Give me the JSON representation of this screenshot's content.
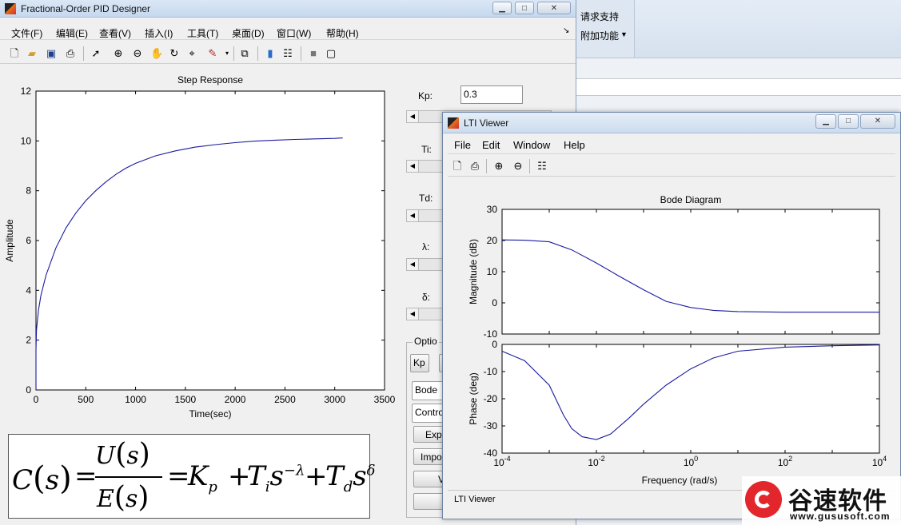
{
  "bg_ribbon": {
    "item1": "请求支持",
    "item2": "附加功能"
  },
  "pid_window": {
    "title": "Fractional-Order PID Designer",
    "menu": [
      "文件(F)",
      "编辑(E)",
      "查看(V)",
      "插入(I)",
      "工具(T)",
      "桌面(D)",
      "窗口(W)",
      "帮助(H)"
    ],
    "toolbar_icons": [
      "new-file-icon",
      "open-folder-icon",
      "save-icon",
      "print-icon",
      "pointer-icon",
      "zoom-in-icon",
      "zoom-out-icon",
      "pan-hand-icon",
      "rotate-3d-icon",
      "data-cursor-icon",
      "brush-icon",
      "link-icon",
      "colorbar-icon",
      "legend-icon",
      "hide-plot-icon",
      "show-plot-icon"
    ],
    "params": {
      "kp_label": "Kp:",
      "kp_value": "0.3",
      "ti_label": "Ti:",
      "td_label": "Td:",
      "lambda_label": "λ:",
      "delta_label": "δ:"
    },
    "options": {
      "group_label": "Optio",
      "kp_button": "Kp",
      "bode_select": "Bode",
      "control_select": "Contro",
      "export_button": "Exp",
      "import_button": "Impo",
      "btn3": "V"
    },
    "formula": {
      "lhs": "C",
      "s": "s",
      "eq": "=",
      "U": "U",
      "E": "E",
      "Kp": "K",
      "p": "p",
      "plus": "+",
      "Ti": "T",
      "i": "i",
      "Td": "T",
      "d": "d",
      "exp_lambda": "−λ",
      "exp_delta": "δ"
    }
  },
  "lti_window": {
    "title": "LTI Viewer",
    "menu": [
      "File",
      "Edit",
      "Window",
      "Help"
    ],
    "status": "LTI Viewer"
  },
  "watermark": {
    "brand": "谷速软件",
    "url": "www.gususoft.com"
  },
  "chart_data": [
    {
      "type": "line",
      "title": "Step Response",
      "xlabel": "Time(sec)",
      "ylabel": "Amplitude",
      "xlim": [
        0,
        3500
      ],
      "ylim": [
        0,
        12
      ],
      "xticks": [
        "0",
        "500",
        "1000",
        "1500",
        "2000",
        "2500",
        "3000",
        "3500"
      ],
      "yticks": [
        "0",
        "2",
        "4",
        "6",
        "8",
        "10",
        "12"
      ],
      "x": [
        0,
        5,
        25,
        50,
        100,
        200,
        300,
        400,
        500,
        600,
        700,
        800,
        900,
        1000,
        1200,
        1400,
        1600,
        1800,
        2000,
        2200,
        2400,
        2600,
        2800,
        3000,
        3080
      ],
      "y": [
        1.6,
        2.4,
        3.2,
        3.8,
        4.6,
        5.7,
        6.5,
        7.1,
        7.6,
        8.0,
        8.35,
        8.65,
        8.9,
        9.1,
        9.4,
        9.6,
        9.75,
        9.85,
        9.93,
        9.99,
        10.03,
        10.06,
        10.08,
        10.1,
        10.12
      ]
    },
    {
      "type": "line",
      "title": "Bode Diagram",
      "xlabel": "Frequency  (rad/s)",
      "xscale": "log",
      "xticks": [
        "10^-4",
        "10^-2",
        "10^0",
        "10^2",
        "10^4"
      ],
      "panels": [
        {
          "ylabel": "Magnitude (dB)",
          "ylim": [
            -10,
            30
          ],
          "yticks": [
            "-10",
            "0",
            "10",
            "20",
            "30"
          ],
          "x": [
            0.0001,
            0.0003,
            0.001,
            0.003,
            0.01,
            0.03,
            0.1,
            0.3,
            1,
            3,
            10,
            100,
            1000,
            10000
          ],
          "y": [
            20.2,
            20.1,
            19.6,
            17.0,
            12.8,
            8.6,
            4.2,
            0.5,
            -1.5,
            -2.4,
            -2.8,
            -3.0,
            -3.0,
            -3.0
          ]
        },
        {
          "ylabel": "Phase (deg)",
          "ylim": [
            -40,
            0
          ],
          "yticks": [
            "-40",
            "-30",
            "-20",
            "-10",
            "0"
          ],
          "x": [
            0.0001,
            0.0003,
            0.001,
            0.002,
            0.003,
            0.005,
            0.01,
            0.02,
            0.05,
            0.1,
            0.3,
            1,
            3,
            10,
            100,
            1000,
            10000
          ],
          "y": [
            -2.5,
            -6,
            -15,
            -26,
            -31,
            -34,
            -35,
            -33,
            -27,
            -22,
            -15,
            -9,
            -5,
            -2.5,
            -1,
            -0.5,
            -0.2
          ]
        }
      ]
    }
  ]
}
